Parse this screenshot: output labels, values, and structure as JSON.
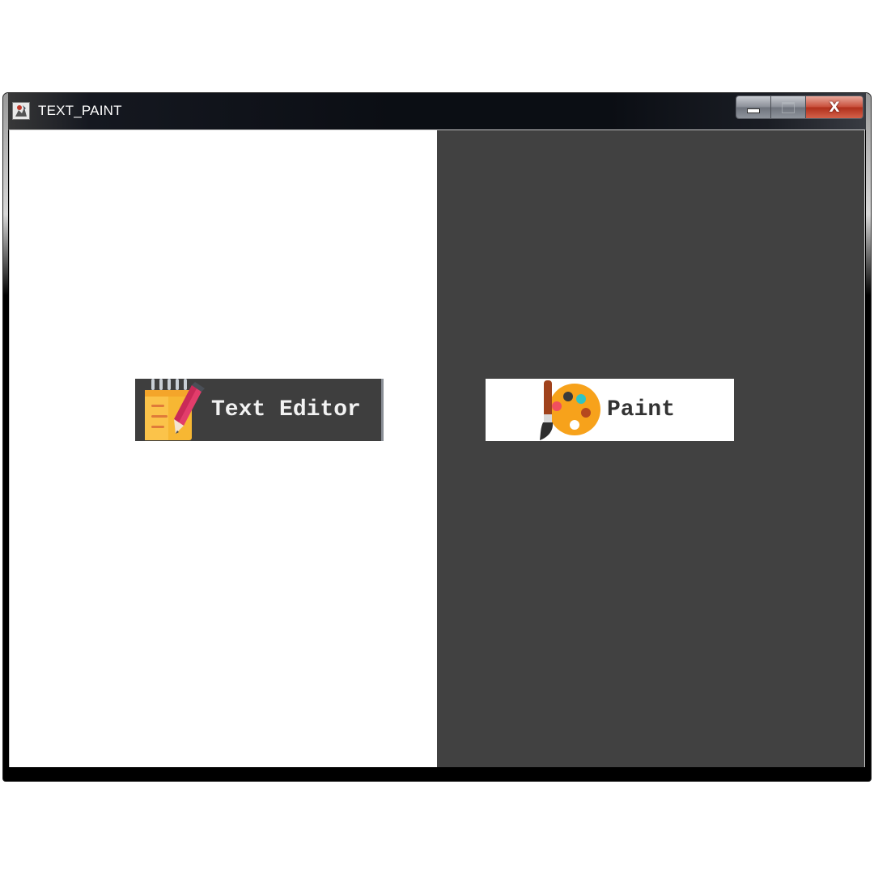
{
  "window": {
    "title": "TEXT_PAINT",
    "app_icon": "java-app-icon",
    "controls": {
      "minimize_icon": "minimize-icon",
      "maximize_icon": "maximize-icon",
      "close_label": "X"
    }
  },
  "panels": {
    "left": {
      "background": "#ffffff",
      "button": {
        "label": "Text Editor",
        "icon": "notepad-pencil-icon",
        "background": "#3e3e3e",
        "text_color": "#f2f2f2"
      }
    },
    "right": {
      "background": "#414141",
      "button": {
        "label": "Paint",
        "icon": "paint-palette-icon",
        "background": "#ffffff",
        "text_color": "#333333"
      }
    }
  }
}
